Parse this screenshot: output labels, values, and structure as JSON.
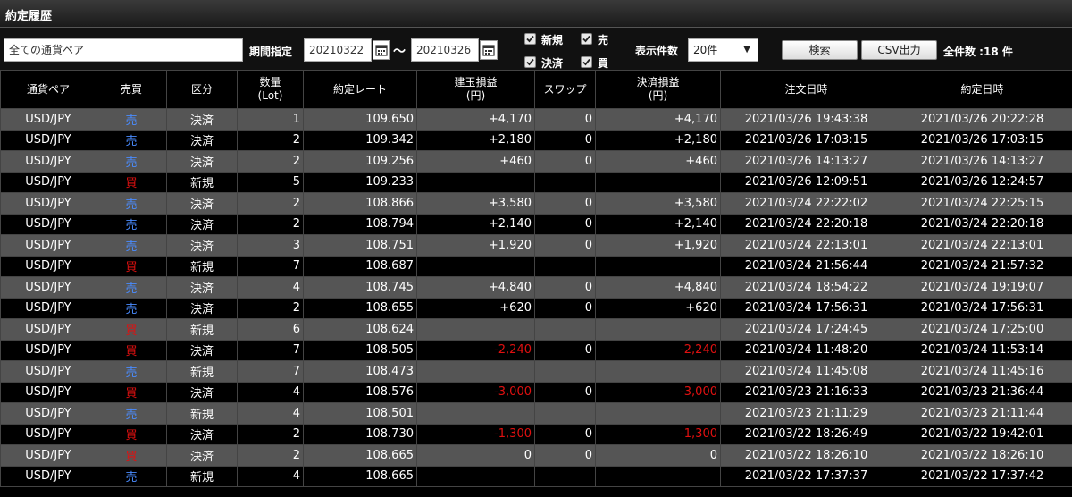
{
  "title": "約定履歴",
  "filters": {
    "currency_pair_placeholder": "全ての通貨ペア",
    "period_label": "期間指定",
    "date_from": "20210322",
    "date_to": "20210326",
    "range_separator": "〜",
    "checkboxes": [
      {
        "label": "新規",
        "checked": true
      },
      {
        "label": "売",
        "checked": true
      },
      {
        "label": "決済",
        "checked": true
      },
      {
        "label": "買",
        "checked": true
      }
    ],
    "display_count_label": "表示件数",
    "display_count_value": "20件",
    "search_button": "検索",
    "csv_button": "CSV出力",
    "total_count": "全件数 :18 件"
  },
  "colors": {
    "sell": "#4a8cff",
    "buy": "#e01010",
    "negative": "#e01010",
    "odd_row": "#555555"
  },
  "table": {
    "headers": [
      "通貨ペア",
      "売買",
      "区分",
      "数量\n(Lot)",
      "約定レート",
      "建玉損益\n(円)",
      "スワップ",
      "決済損益\n(円)",
      "注文日時",
      "約定日時"
    ],
    "rows": [
      {
        "pair": "USD/JPY",
        "side": "売",
        "kind": "決済",
        "qty": "1",
        "rate": "109.650",
        "pos_pl": "+4,170",
        "swap": "0",
        "settle_pl": "+4,170",
        "order_time": "2021/03/26 19:43:38",
        "exec_time": "2021/03/26 20:22:28"
      },
      {
        "pair": "USD/JPY",
        "side": "売",
        "kind": "決済",
        "qty": "2",
        "rate": "109.342",
        "pos_pl": "+2,180",
        "swap": "0",
        "settle_pl": "+2,180",
        "order_time": "2021/03/26 17:03:15",
        "exec_time": "2021/03/26 17:03:15"
      },
      {
        "pair": "USD/JPY",
        "side": "売",
        "kind": "決済",
        "qty": "2",
        "rate": "109.256",
        "pos_pl": "+460",
        "swap": "0",
        "settle_pl": "+460",
        "order_time": "2021/03/26 14:13:27",
        "exec_time": "2021/03/26 14:13:27"
      },
      {
        "pair": "USD/JPY",
        "side": "買",
        "kind": "新規",
        "qty": "5",
        "rate": "109.233",
        "pos_pl": "",
        "swap": "",
        "settle_pl": "",
        "order_time": "2021/03/26 12:09:51",
        "exec_time": "2021/03/26 12:24:57"
      },
      {
        "pair": "USD/JPY",
        "side": "売",
        "kind": "決済",
        "qty": "2",
        "rate": "108.866",
        "pos_pl": "+3,580",
        "swap": "0",
        "settle_pl": "+3,580",
        "order_time": "2021/03/24 22:22:02",
        "exec_time": "2021/03/24 22:25:15"
      },
      {
        "pair": "USD/JPY",
        "side": "売",
        "kind": "決済",
        "qty": "2",
        "rate": "108.794",
        "pos_pl": "+2,140",
        "swap": "0",
        "settle_pl": "+2,140",
        "order_time": "2021/03/24 22:20:18",
        "exec_time": "2021/03/24 22:20:18"
      },
      {
        "pair": "USD/JPY",
        "side": "売",
        "kind": "決済",
        "qty": "3",
        "rate": "108.751",
        "pos_pl": "+1,920",
        "swap": "0",
        "settle_pl": "+1,920",
        "order_time": "2021/03/24 22:13:01",
        "exec_time": "2021/03/24 22:13:01"
      },
      {
        "pair": "USD/JPY",
        "side": "買",
        "kind": "新規",
        "qty": "7",
        "rate": "108.687",
        "pos_pl": "",
        "swap": "",
        "settle_pl": "",
        "order_time": "2021/03/24 21:56:44",
        "exec_time": "2021/03/24 21:57:32"
      },
      {
        "pair": "USD/JPY",
        "side": "売",
        "kind": "決済",
        "qty": "4",
        "rate": "108.745",
        "pos_pl": "+4,840",
        "swap": "0",
        "settle_pl": "+4,840",
        "order_time": "2021/03/24 18:54:22",
        "exec_time": "2021/03/24 19:19:07"
      },
      {
        "pair": "USD/JPY",
        "side": "売",
        "kind": "決済",
        "qty": "2",
        "rate": "108.655",
        "pos_pl": "+620",
        "swap": "0",
        "settle_pl": "+620",
        "order_time": "2021/03/24 17:56:31",
        "exec_time": "2021/03/24 17:56:31"
      },
      {
        "pair": "USD/JPY",
        "side": "買",
        "kind": "新規",
        "qty": "6",
        "rate": "108.624",
        "pos_pl": "",
        "swap": "",
        "settle_pl": "",
        "order_time": "2021/03/24 17:24:45",
        "exec_time": "2021/03/24 17:25:00"
      },
      {
        "pair": "USD/JPY",
        "side": "買",
        "kind": "決済",
        "qty": "7",
        "rate": "108.505",
        "pos_pl": "-2,240",
        "swap": "0",
        "settle_pl": "-2,240",
        "order_time": "2021/03/24 11:48:20",
        "exec_time": "2021/03/24 11:53:14"
      },
      {
        "pair": "USD/JPY",
        "side": "売",
        "kind": "新規",
        "qty": "7",
        "rate": "108.473",
        "pos_pl": "",
        "swap": "",
        "settle_pl": "",
        "order_time": "2021/03/24 11:45:08",
        "exec_time": "2021/03/24 11:45:16"
      },
      {
        "pair": "USD/JPY",
        "side": "買",
        "kind": "決済",
        "qty": "4",
        "rate": "108.576",
        "pos_pl": "-3,000",
        "swap": "0",
        "settle_pl": "-3,000",
        "order_time": "2021/03/23 21:16:33",
        "exec_time": "2021/03/23 21:36:44"
      },
      {
        "pair": "USD/JPY",
        "side": "売",
        "kind": "新規",
        "qty": "4",
        "rate": "108.501",
        "pos_pl": "",
        "swap": "",
        "settle_pl": "",
        "order_time": "2021/03/23 21:11:29",
        "exec_time": "2021/03/23 21:11:44"
      },
      {
        "pair": "USD/JPY",
        "side": "買",
        "kind": "決済",
        "qty": "2",
        "rate": "108.730",
        "pos_pl": "-1,300",
        "swap": "0",
        "settle_pl": "-1,300",
        "order_time": "2021/03/22 18:26:49",
        "exec_time": "2021/03/22 19:42:01"
      },
      {
        "pair": "USD/JPY",
        "side": "買",
        "kind": "決済",
        "qty": "2",
        "rate": "108.665",
        "pos_pl": "0",
        "swap": "0",
        "settle_pl": "0",
        "order_time": "2021/03/22 18:26:10",
        "exec_time": "2021/03/22 18:26:10"
      },
      {
        "pair": "USD/JPY",
        "side": "売",
        "kind": "新規",
        "qty": "4",
        "rate": "108.665",
        "pos_pl": "",
        "swap": "",
        "settle_pl": "",
        "order_time": "2021/03/22 17:37:37",
        "exec_time": "2021/03/22 17:37:42"
      }
    ]
  }
}
